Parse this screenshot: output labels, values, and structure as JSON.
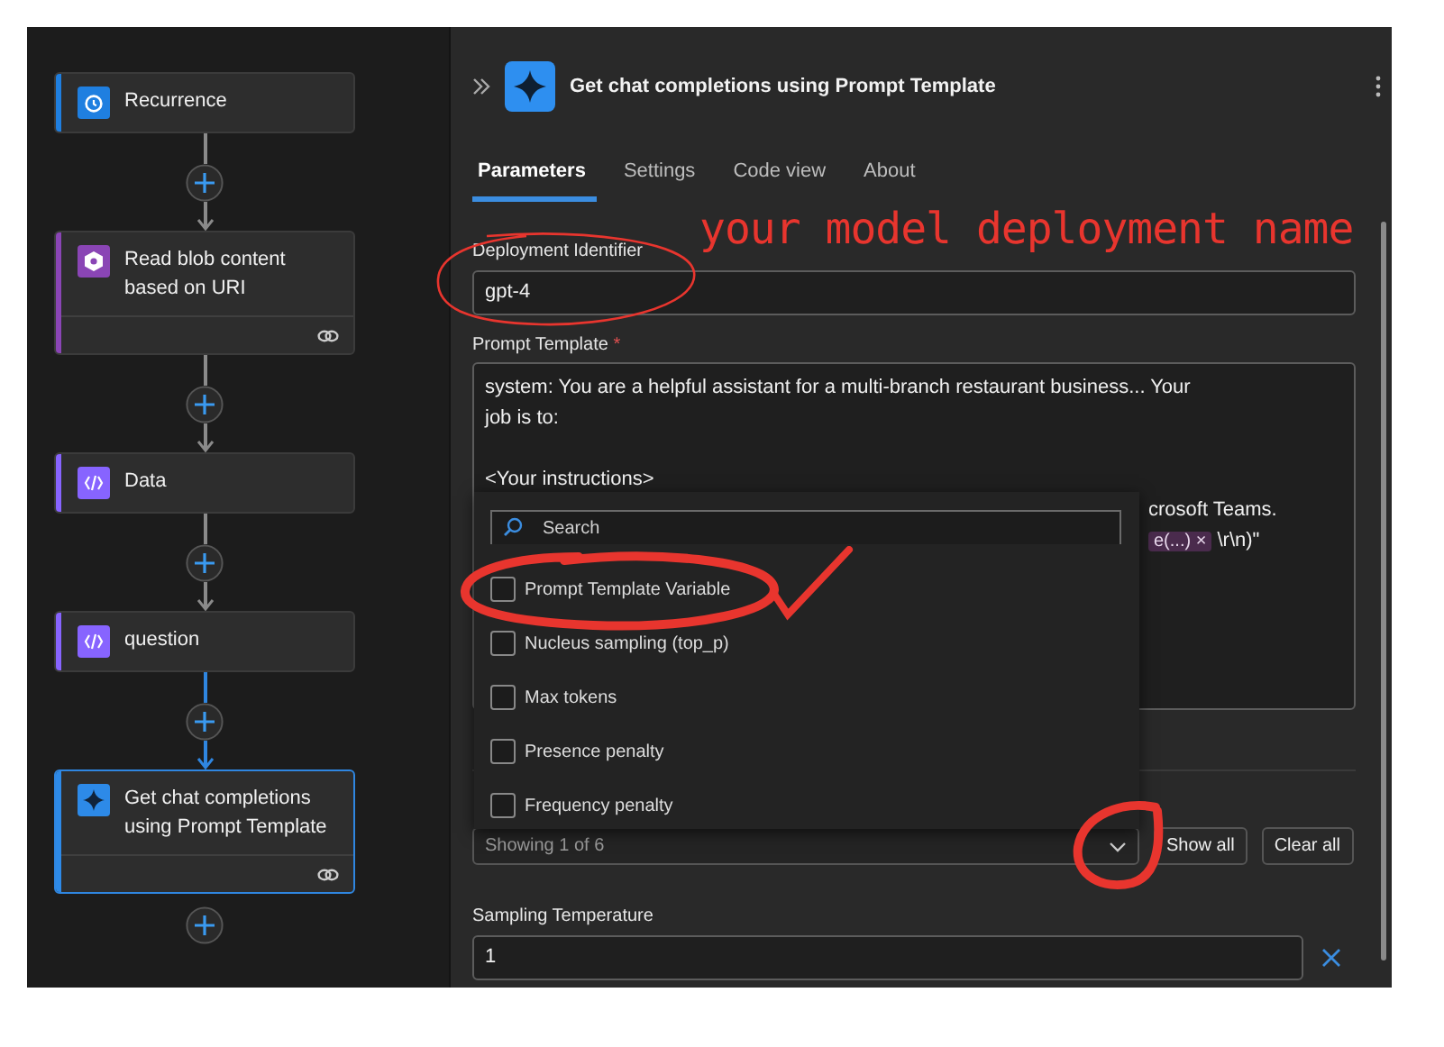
{
  "flow": {
    "steps": [
      {
        "title": "Recurrence",
        "kind": "clock",
        "color": "#1f7fe0",
        "selected": false,
        "connected": false
      },
      {
        "title": "Read blob content based on URI",
        "kind": "blob",
        "color": "#8a45b5",
        "selected": false,
        "connected": true
      },
      {
        "title": "Data",
        "kind": "variable",
        "color": "#8764ff",
        "selected": false,
        "connected": false
      },
      {
        "title": "question",
        "kind": "variable",
        "color": "#8764ff",
        "selected": false,
        "connected": false
      },
      {
        "title": "Get chat completions using Prompt Template",
        "kind": "sparkle",
        "color": "#2d8ae8",
        "selected": true,
        "connected": true
      }
    ]
  },
  "panel": {
    "title": "Get chat completions using Prompt Template",
    "tabs": [
      {
        "label": "Parameters",
        "selected": true
      },
      {
        "label": "Settings",
        "selected": false
      },
      {
        "label": "Code view",
        "selected": false
      },
      {
        "label": "About",
        "selected": false
      }
    ],
    "deployment": {
      "label": "Deployment Identifier",
      "value": "gpt-4"
    },
    "prompt": {
      "label": "Prompt Template",
      "required_mark": "*",
      "paragraphs": [
        "system: You are a helpful assistant for a multi-branch restaurant business... Your\njob is to:",
        "<Your instructions>"
      ],
      "partial_line": "crosoft Teams.",
      "token": "e(...)",
      "token_close": "×",
      "after_token": "\\r\\n)\""
    },
    "parameters_dropdown": {
      "search_placeholder": "Search",
      "options": [
        {
          "label": "Prompt Template Variable",
          "checked": false
        },
        {
          "label": "Nucleus sampling (top_p)",
          "checked": false
        },
        {
          "label": "Max tokens",
          "checked": false
        },
        {
          "label": "Presence penalty",
          "checked": false
        },
        {
          "label": "Frequency penalty",
          "checked": false
        }
      ],
      "summary": "Showing 1 of 6",
      "expanded": true
    },
    "buttons": [
      "Show all",
      "Clear all"
    ],
    "temperature": {
      "label": "Sampling Temperature",
      "value": "1"
    }
  },
  "annotation": {
    "note": "your model deployment name"
  }
}
